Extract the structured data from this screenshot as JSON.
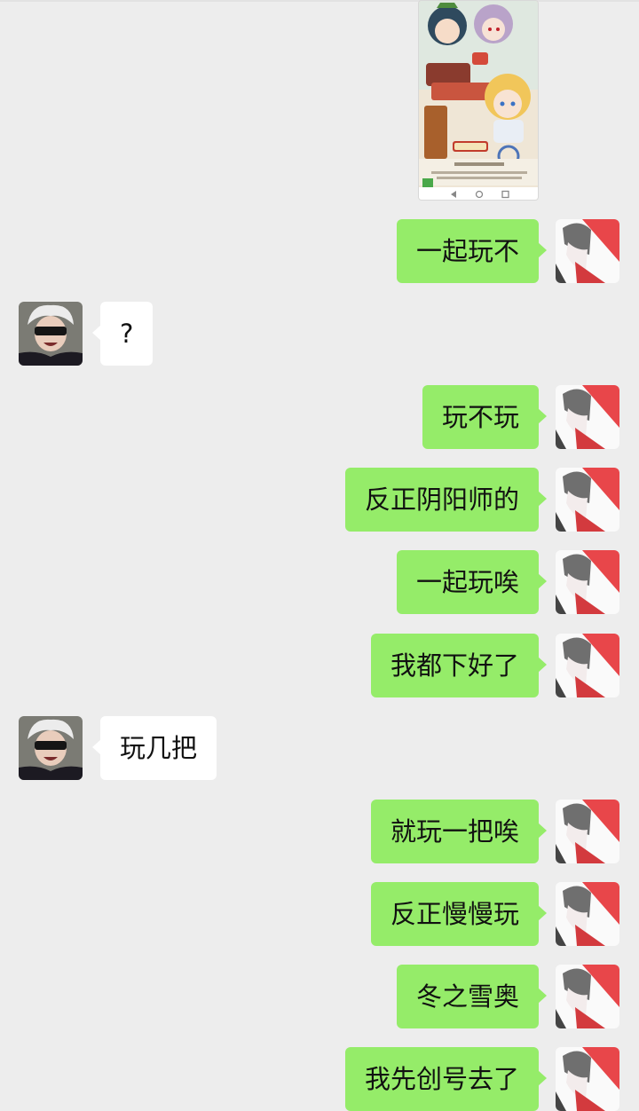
{
  "chat": {
    "shared_image": {
      "icon": "game-screenshot-image"
    },
    "messages": [
      {
        "sender": "me",
        "text": "一起玩不"
      },
      {
        "sender": "other",
        "text": "?"
      },
      {
        "sender": "me",
        "text": "玩不玩"
      },
      {
        "sender": "me",
        "text": "反正阴阳师的"
      },
      {
        "sender": "me",
        "text": "一起玩唉"
      },
      {
        "sender": "me",
        "text": "我都下好了"
      },
      {
        "sender": "other",
        "text": "玩几把"
      },
      {
        "sender": "me",
        "text": "就玩一把唉"
      },
      {
        "sender": "me",
        "text": "反正慢慢玩"
      },
      {
        "sender": "me",
        "text": "冬之雪奥"
      },
      {
        "sender": "me",
        "text": "我先创号去了"
      }
    ]
  },
  "colors": {
    "background": "#ededed",
    "outgoing_bubble": "#95ec69",
    "incoming_bubble": "#ffffff"
  }
}
